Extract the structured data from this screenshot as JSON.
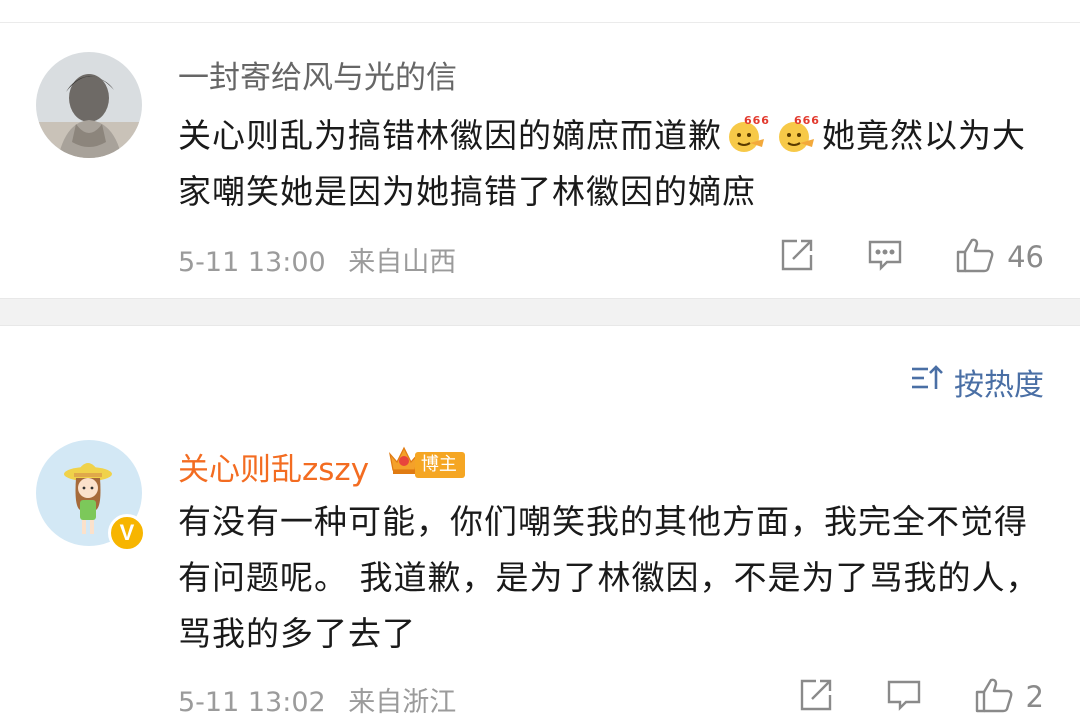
{
  "comments": [
    {
      "username": "一封寄给风与光的信",
      "text_part1": "关心则乱为搞错林徽因的嫡庶而道歉",
      "emoji_label": "666",
      "text_part2": "她竟然以为大家嘲笑她是因为她搞错了林徽因的嫡庶",
      "timestamp": "5-11 13:00",
      "location": "来自山西",
      "like_count": "46",
      "share_icon": "share-icon",
      "comment_icon": "comment-icon",
      "like_icon": "thumbs-up-icon"
    },
    {
      "username": "关心则乱zszy",
      "badge_label": "博主",
      "verified_label": "V",
      "text": "有没有一种可能，你们嘲笑我的其他方面，我完全不觉得有问题呢。 我道歉，是为了林徽因，不是为了骂我的人，骂我的多了去了",
      "timestamp": "5-11 13:02",
      "location": "来自浙江",
      "like_count": "2"
    }
  ],
  "sort": {
    "label": "按热度",
    "icon": "sort-icon"
  },
  "colors": {
    "username_gray": "#666666",
    "username_orange": "#f36c21",
    "accent_blue": "#4a6fa5",
    "verified_yellow": "#f7b500"
  }
}
